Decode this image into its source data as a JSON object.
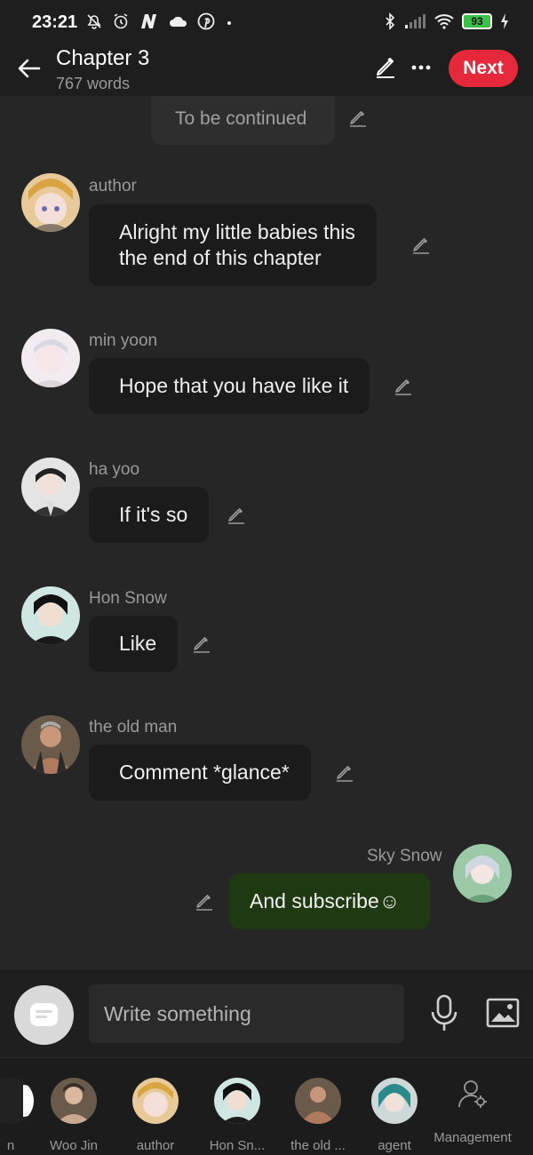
{
  "status_bar": {
    "time": "23:21",
    "battery": "93",
    "icons_left": [
      "mute-bell-icon",
      "alarm-icon",
      "n-logo-icon",
      "cloud-icon",
      "pinterest-icon",
      "dot-icon"
    ],
    "icons_right": [
      "bluetooth-icon",
      "signal-icon",
      "wifi-icon",
      "battery-icon",
      "charging-icon"
    ]
  },
  "header": {
    "title": "Chapter 3",
    "subtitle": "767 words",
    "next_label": "Next",
    "accent_color": "#e5293a"
  },
  "pinned": {
    "text": "To be continued"
  },
  "messages": [
    {
      "sender": "author",
      "text_lines": [
        "Alright my little babies this",
        "the end of this chapter"
      ],
      "self": false
    },
    {
      "sender": "min yoon",
      "text_lines": [
        "Hope that you have like it"
      ],
      "self": false
    },
    {
      "sender": "ha yoo",
      "text_lines": [
        "If it's so"
      ],
      "self": false
    },
    {
      "sender": "Hon Snow",
      "text_lines": [
        "Like"
      ],
      "self": false
    },
    {
      "sender": "the old man",
      "text_lines": [
        "Comment *glance*"
      ],
      "self": false
    },
    {
      "sender": "Sky Snow",
      "text_lines": [
        "And subscribe☺"
      ],
      "self": true
    }
  ],
  "composer": {
    "placeholder": "Write something"
  },
  "characters": [
    {
      "name": "n"
    },
    {
      "name": "Woo Jin"
    },
    {
      "name": "author"
    },
    {
      "name": "Hon Sn..."
    },
    {
      "name": "the old ..."
    },
    {
      "name": "agent"
    }
  ],
  "management_label": "Management",
  "colors": {
    "background": "#262626",
    "bubble_other": "#1b1b1b",
    "bubble_self": "#1f3a12",
    "bar": "#1e1e1e"
  }
}
